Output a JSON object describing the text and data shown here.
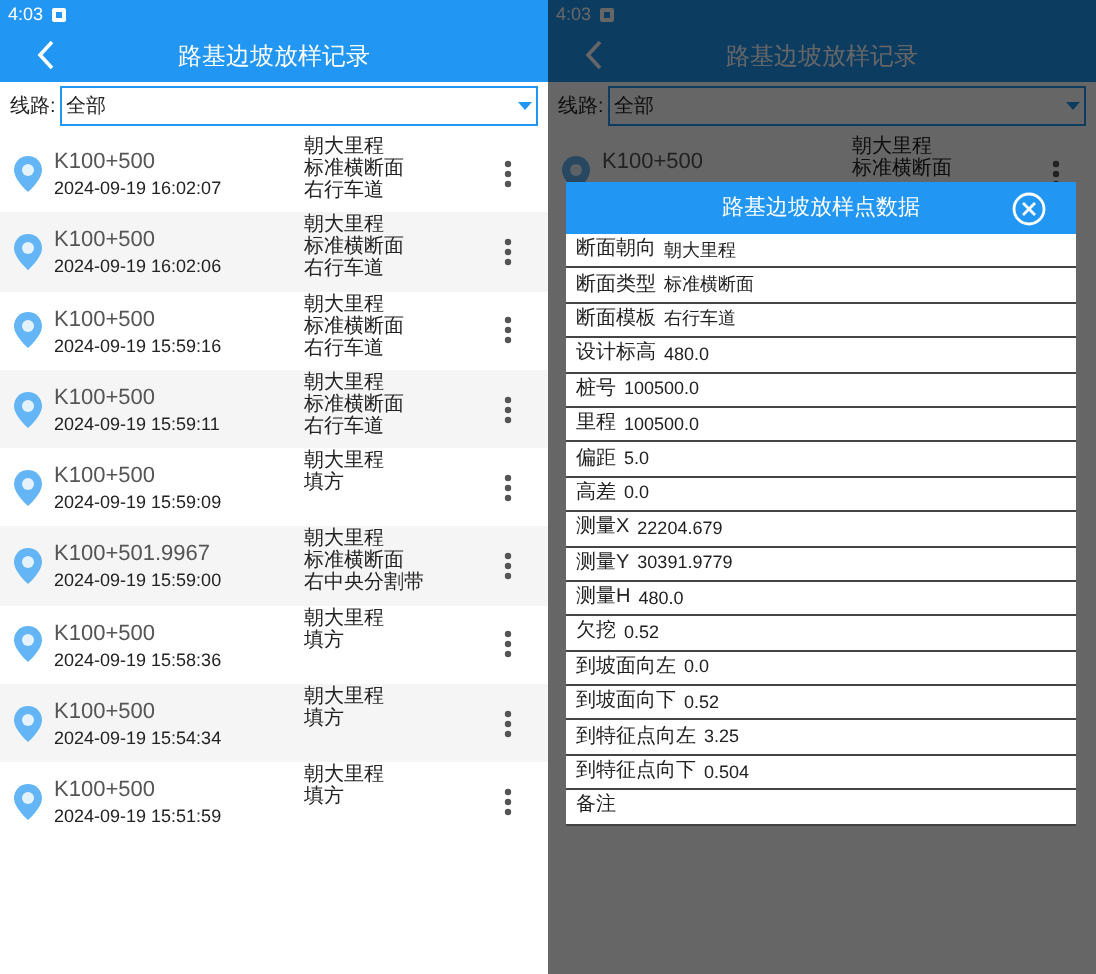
{
  "screens": [
    {
      "status_time": "4:03",
      "title": "路基边坡放样记录",
      "filter": {
        "label": "线路:",
        "value": "全部"
      },
      "records": [
        {
          "station": "K100+500",
          "time": "2024-09-19 16:02:07",
          "details": [
            "朝大里程",
            "标准横断面",
            "右行车道"
          ]
        },
        {
          "station": "K100+500",
          "time": "2024-09-19 16:02:06",
          "details": [
            "朝大里程",
            "标准横断面",
            "右行车道"
          ]
        },
        {
          "station": "K100+500",
          "time": "2024-09-19 15:59:16",
          "details": [
            "朝大里程",
            "标准横断面",
            "右行车道"
          ]
        },
        {
          "station": "K100+500",
          "time": "2024-09-19 15:59:11",
          "details": [
            "朝大里程",
            "标准横断面",
            "右行车道"
          ]
        },
        {
          "station": "K100+500",
          "time": "2024-09-19 15:59:09",
          "details": [
            "朝大里程",
            "填方"
          ]
        },
        {
          "station": "K100+501.9967",
          "time": "2024-09-19 15:59:00",
          "details": [
            "朝大里程",
            "标准横断面",
            "右中央分割带"
          ]
        },
        {
          "station": "K100+500",
          "time": "2024-09-19 15:58:36",
          "details": [
            "朝大里程",
            "填方"
          ]
        },
        {
          "station": "K100+500",
          "time": "2024-09-19 15:54:34",
          "details": [
            "朝大里程",
            "填方"
          ]
        },
        {
          "station": "K100+500",
          "time": "2024-09-19 15:51:59",
          "details": [
            "朝大里程",
            "填方"
          ]
        }
      ]
    },
    {
      "status_time": "4:03",
      "title": "路基边坡放样记录",
      "filter": {
        "label": "线路:",
        "value": "全部"
      },
      "records": [
        {
          "station": "K100+500",
          "details": [
            "朝大里程",
            "标准横断面"
          ]
        }
      ],
      "dialog": {
        "title": "路基边坡放样点数据",
        "fields": [
          {
            "label": "断面朝向",
            "value": "朝大里程"
          },
          {
            "label": "断面类型",
            "value": "标准横断面"
          },
          {
            "label": "断面模板",
            "value": "右行车道"
          },
          {
            "label": "设计标高",
            "value": "480.0"
          },
          {
            "label": "桩号",
            "value": "100500.0"
          },
          {
            "label": "里程",
            "value": "100500.0"
          },
          {
            "label": "偏距",
            "value": "5.0"
          },
          {
            "label": "高差",
            "value": "0.0"
          },
          {
            "label": "测量X",
            "value": "22204.679"
          },
          {
            "label": "测量Y",
            "value": "30391.9779"
          },
          {
            "label": "测量H",
            "value": "480.0"
          },
          {
            "label": "欠挖",
            "value": "0.52"
          },
          {
            "label": "到坡面向左",
            "value": "0.0"
          },
          {
            "label": "到坡面向下",
            "value": "0.52"
          },
          {
            "label": "到特征点向左",
            "value": "3.25"
          },
          {
            "label": "到特征点向下",
            "value": "0.504"
          },
          {
            "label": "备注"
          }
        ]
      }
    }
  ]
}
